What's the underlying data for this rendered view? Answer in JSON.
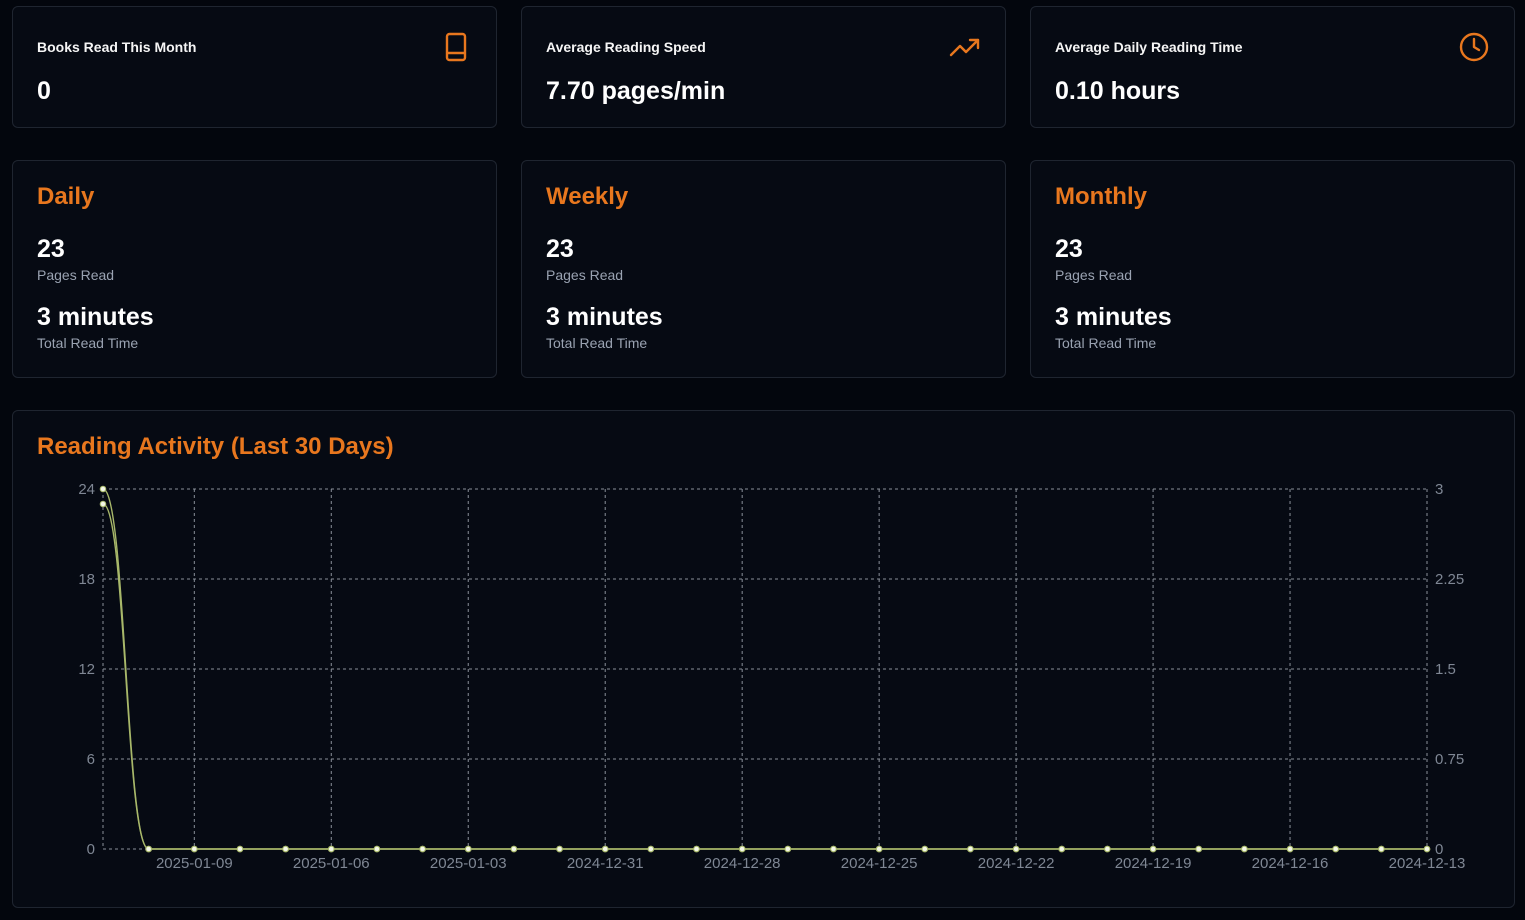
{
  "stats": [
    {
      "label": "Books Read This Month",
      "value": "0",
      "icon": "book-icon"
    },
    {
      "label": "Average Reading Speed",
      "value": "7.70 pages/min",
      "icon": "trending-up-icon"
    },
    {
      "label": "Average Daily Reading Time",
      "value": "0.10 hours",
      "icon": "clock-icon"
    }
  ],
  "periods": [
    {
      "title": "Daily",
      "pages": "23",
      "pages_label": "Pages Read",
      "time": "3 minutes",
      "time_label": "Total Read Time"
    },
    {
      "title": "Weekly",
      "pages": "23",
      "pages_label": "Pages Read",
      "time": "3 minutes",
      "time_label": "Total Read Time"
    },
    {
      "title": "Monthly",
      "pages": "23",
      "pages_label": "Pages Read",
      "time": "3 minutes",
      "time_label": "Total Read Time"
    }
  ],
  "colors": {
    "accent": "#e8771e",
    "line": "#a8b86a",
    "point": "#f3f7e8"
  },
  "chart_data": {
    "type": "line",
    "title": "Reading Activity (Last 30 Days)",
    "x": [
      "2025-01-11",
      "2025-01-10",
      "2025-01-09",
      "2025-01-08",
      "2025-01-07",
      "2025-01-06",
      "2025-01-05",
      "2025-01-04",
      "2025-01-03",
      "2025-01-02",
      "2025-01-01",
      "2024-12-31",
      "2024-12-30",
      "2024-12-29",
      "2024-12-28",
      "2024-12-27",
      "2024-12-26",
      "2024-12-25",
      "2024-12-24",
      "2024-12-23",
      "2024-12-22",
      "2024-12-21",
      "2024-12-20",
      "2024-12-19",
      "2024-12-18",
      "2024-12-17",
      "2024-12-16",
      "2024-12-15",
      "2024-12-14",
      "2024-12-13"
    ],
    "x_tick_labels": [
      "2025-01-09",
      "2025-01-06",
      "2025-01-03",
      "2024-12-31",
      "2024-12-28",
      "2024-12-25",
      "2024-12-22",
      "2024-12-19",
      "2024-12-16",
      "2024-12-13"
    ],
    "series": [
      {
        "axis": "left",
        "values": [
          23,
          0,
          0,
          0,
          0,
          0,
          0,
          0,
          0,
          0,
          0,
          0,
          0,
          0,
          0,
          0,
          0,
          0,
          0,
          0,
          0,
          0,
          0,
          0,
          0,
          0,
          0,
          0,
          0,
          0
        ]
      },
      {
        "axis": "right",
        "values": [
          3,
          0,
          0,
          0,
          0,
          0,
          0,
          0,
          0,
          0,
          0,
          0,
          0,
          0,
          0,
          0,
          0,
          0,
          0,
          0,
          0,
          0,
          0,
          0,
          0,
          0,
          0,
          0,
          0,
          0
        ]
      }
    ],
    "y_left": {
      "ylim": [
        0,
        24
      ],
      "ticks": [
        "0",
        "6",
        "12",
        "18",
        "24"
      ]
    },
    "y_right": {
      "ylim": [
        0,
        3
      ],
      "ticks": [
        "0",
        "0.75",
        "1.5",
        "2.25",
        "3"
      ]
    },
    "grid": true
  }
}
